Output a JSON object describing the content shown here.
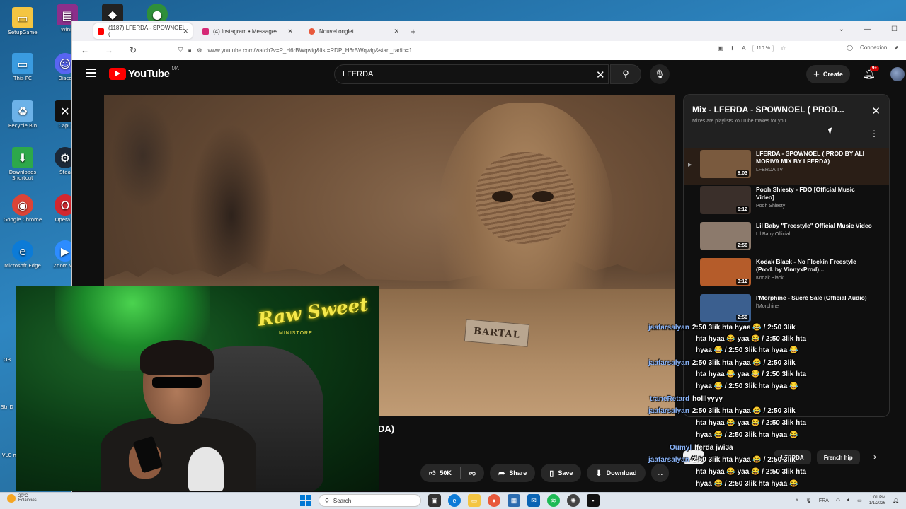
{
  "desktop": {
    "icons": [
      {
        "label": "SetupGame",
        "icon": "folder-icon",
        "color": "#f4c542"
      },
      {
        "label": "WinR",
        "icon": "winrar-icon",
        "color": "#8b2f8b"
      },
      {
        "label": "This PC",
        "icon": "monitor-icon",
        "color": "#3a9be0"
      },
      {
        "label": "Disco",
        "icon": "discord-icon",
        "color": "#5865f2"
      },
      {
        "label": "Recycle Bin",
        "icon": "recycle-bin-icon",
        "color": "#6cb2e8"
      },
      {
        "label": "CapC",
        "icon": "capcut-icon",
        "color": "#111111"
      },
      {
        "label": "Downloads Shortcut",
        "icon": "downloads-folder-icon",
        "color": "#2da84a"
      },
      {
        "label": "Stea",
        "icon": "steam-icon",
        "color": "#1b2838"
      },
      {
        "label": "Google Chrome",
        "icon": "chrome-icon",
        "color": "#db4437"
      },
      {
        "label": "Opera B",
        "icon": "opera-icon",
        "color": "#d3272f"
      },
      {
        "label": "Microsoft Edge",
        "icon": "edge-icon",
        "color": "#0c7bd7"
      },
      {
        "label": "Zoom Wo",
        "icon": "zoom-icon",
        "color": "#2d8cff"
      }
    ],
    "side_fragments": [
      "OB",
      "Str D",
      "VLC m"
    ]
  },
  "browser": {
    "tabs": [
      {
        "title": "(1187) LFERDA - SPOWNOEL (",
        "favicon_color": "#ff0000",
        "active": true
      },
      {
        "title": "(4) Instagram • Messages",
        "favicon_color": "#d62976",
        "active": false
      },
      {
        "title": "Nouvel onglet",
        "favicon_color": "#e8593c",
        "active": false
      }
    ],
    "url": "www.youtube.com/watch?v=P_H6rBWqwig&list=RDP_H6rBWqwig&start_radio=1",
    "zoom": "110 %",
    "connexion_label": "Connexion"
  },
  "youtube": {
    "wordmark": "YouTube",
    "region": "MA",
    "search_query": "LFERDA",
    "create_label": "Create",
    "notification_count": "9+",
    "video": {
      "sign_text": "BARTAL",
      "title_fragment": "DA)"
    },
    "actions": {
      "likes": "50K",
      "share": "Share",
      "save": "Save",
      "download": "Download",
      "more": "..."
    },
    "playlist": {
      "title": "Mix - LFERDA - SPOWNOEL ( PROD...",
      "subtitle": "Mixes are playlists YouTube makes for you",
      "items": [
        {
          "title": "LFERDA - SPOWNOEL ( PROD BY ALI MORIVA MIX BY LFERDA)",
          "channel": "LFERDA TV",
          "duration": "8:03",
          "thumb": "#7a5a3e",
          "active": true
        },
        {
          "title": "Pooh Shiesty - FDO [Official Music Video]",
          "channel": "Pooh Shiesty",
          "duration": "6:12",
          "thumb": "#3a2f2a",
          "active": false
        },
        {
          "title": "Lil Baby \"Freestyle\" Official Music Video",
          "channel": "Lil Baby Official",
          "duration": "2:56",
          "thumb": "#8c7a6c",
          "active": false
        },
        {
          "title": "Kodak Black - No Flockin Freestyle (Prod. by VinnyxProd)...",
          "channel": "Kodak Black",
          "duration": "3:12",
          "thumb": "#b55c2a",
          "active": false
        },
        {
          "title": "l'Morphine - Sucré Salé (Official Audio)",
          "channel": "l'Morphine",
          "duration": "2:50",
          "thumb": "#3b5f8f",
          "active": false
        }
      ]
    },
    "chips": [
      "All",
      "LFERDA",
      "French hip"
    ]
  },
  "chat": [
    {
      "user": "jaafarsalyan",
      "text": "2:50 3lik hta hyaa 😂 / 2:50 3lik"
    },
    {
      "user": "",
      "text": "hta hyaa 😂 yaa 😂 / 2:50 3lik hta"
    },
    {
      "user": "",
      "text": "hyaa 😂 / 2:50 3lik hta hyaa 😂"
    },
    {
      "user": "jaafarsalyan",
      "text": "2:50 3lik hta hyaa 😂 / 2:50 3lik"
    },
    {
      "user": "",
      "text": "hta hyaa 😂 yaa 😂 / 2:50 3lik hta"
    },
    {
      "user": "",
      "text": "hyaa 😂 / 2:50 3lik hta hyaa 😂"
    },
    {
      "user": "traneRetard",
      "text": "holllyyyy"
    },
    {
      "user": "jaafarsalyan",
      "text": "2:50 3lik hta hyaa 😂 / 2:50 3lik"
    },
    {
      "user": "",
      "text": "hta hyaa 😂 yaa 😂 / 2:50 3lik hta"
    },
    {
      "user": "",
      "text": "hyaa 😂 / 2:50 3lik hta hyaa 😂"
    },
    {
      "user": "Oumyl",
      "text": "lferda jwi3a"
    },
    {
      "user": "jaafarsalyan",
      "text": "2:50 3lik hta hyaa 😂 / 2:50 3lik"
    },
    {
      "user": "",
      "text": "hta hyaa 😂 yaa 😂 / 2:50 3lik hta"
    },
    {
      "user": "",
      "text": "hyaa 😂 / 2:50 3lik hta hyaa 😂"
    }
  ],
  "webcam": {
    "neon_text": "Raw Sweet",
    "neon_sub": "MINISTORE"
  },
  "taskbar": {
    "weather_temp": "20°C",
    "weather_desc": "Éclaircies",
    "search_label": "Search",
    "lang": "FRA",
    "time": "1:01 PM",
    "date": "1/1/2026"
  }
}
